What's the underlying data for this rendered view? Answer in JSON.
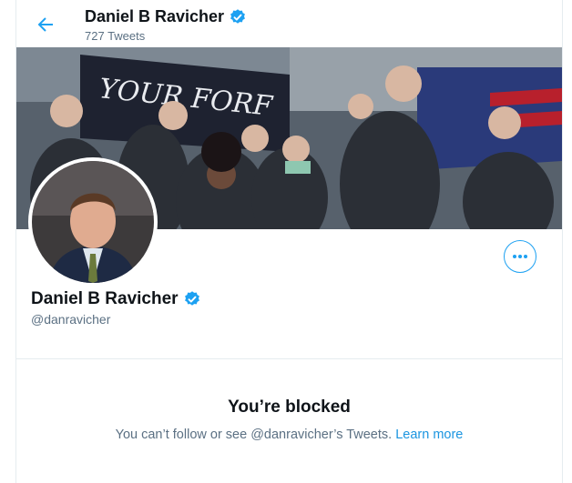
{
  "header": {
    "display_name": "Daniel B Ravicher",
    "tweet_count": "727 Tweets"
  },
  "profile": {
    "display_name": "Daniel B Ravicher",
    "handle": "@danravicher"
  },
  "blocked": {
    "title": "You’re blocked",
    "message": "You can’t follow or see @danravicher’s Tweets.",
    "learn_more": "Learn more"
  },
  "banner": {
    "sign_text": "YOUR FORF"
  },
  "icons": {
    "back": "arrow-left-icon",
    "verified": "verified-badge-icon",
    "more": "more-horizontal-icon"
  },
  "colors": {
    "accent": "#1da1f2",
    "link": "#1b95e0",
    "secondary_text": "#5b7083",
    "divider": "#e6ecf0"
  }
}
